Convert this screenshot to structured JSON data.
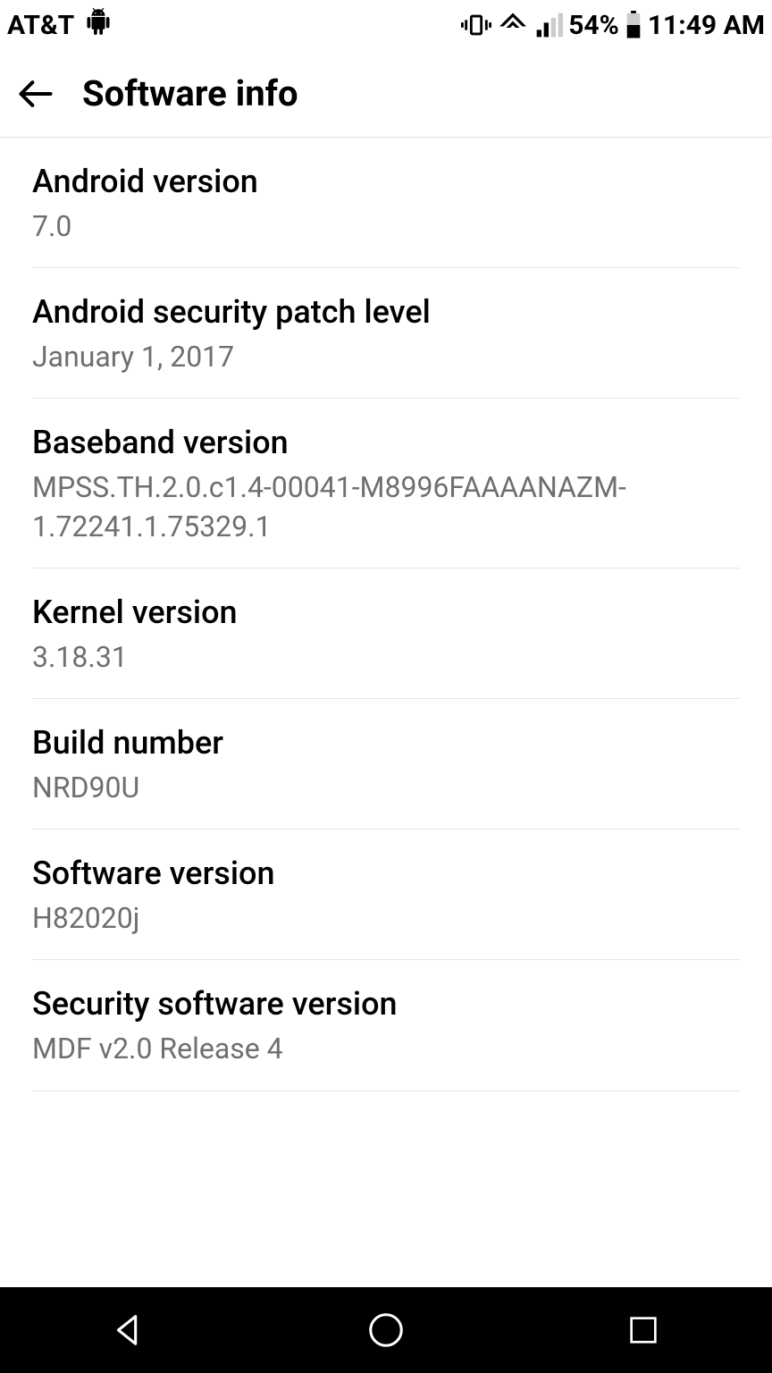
{
  "statusbar": {
    "carrier": "AT&T",
    "battery_pct": "54%",
    "time": "11:49 AM"
  },
  "header": {
    "title": "Software info"
  },
  "items": [
    {
      "label": "Android version",
      "value": "7.0"
    },
    {
      "label": "Android security patch level",
      "value": "January 1, 2017"
    },
    {
      "label": "Baseband version",
      "value": "MPSS.TH.2.0.c1.4-00041-M8996FAAAANAZM-1.72241.1.75329.1"
    },
    {
      "label": "Kernel version",
      "value": "3.18.31"
    },
    {
      "label": "Build number",
      "value": "NRD90U"
    },
    {
      "label": "Software version",
      "value": "H82020j"
    },
    {
      "label": "Security software version",
      "value": "MDF v2.0 Release 4"
    }
  ]
}
